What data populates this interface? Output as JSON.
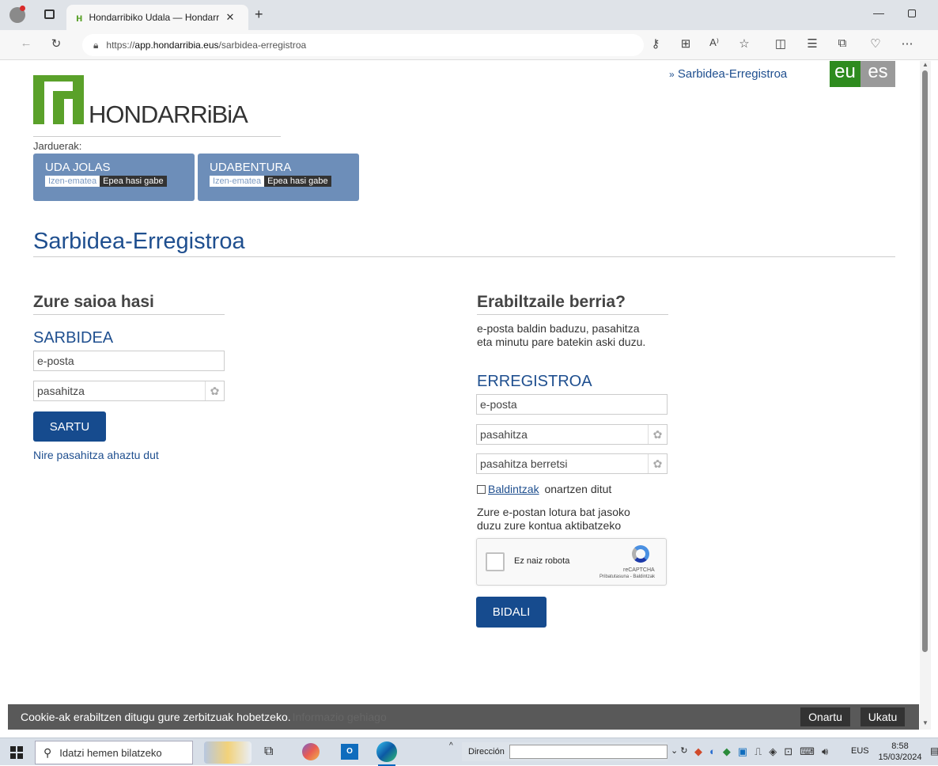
{
  "browser": {
    "tab_title": "Hondarribiko Udala — Hondarrib",
    "url_prefix": "https://",
    "url_domain": "app.hondarribia.eus",
    "url_path": "/sarbidea-erregistroa"
  },
  "header": {
    "logo_text": "HONDARRiBiA",
    "breadcrumb": "Sarbidea-Erregistroa",
    "lang_eu": "eu",
    "lang_es": "es",
    "activities_label": "Jarduerak:",
    "activities": [
      {
        "title": "UDA JOLAS",
        "tag1": "Izen-ematea",
        "tag2": "Epea hasi gabe"
      },
      {
        "title": "UDABENTURA",
        "tag1": "Izen-ematea",
        "tag2": "Epea hasi gabe"
      }
    ]
  },
  "page_title": "Sarbidea-Erregistroa",
  "login": {
    "heading": "Zure saioa hasi",
    "subheading": "SARBIDEA",
    "email_placeholder": "e-posta",
    "password_placeholder": "pasahitza",
    "submit": "SARTU",
    "forgot": "Nire pasahitza ahaztu dut"
  },
  "register": {
    "heading": "Erabiltzaile berria?",
    "intro_line1": "e-posta baldin baduzu, pasahitza",
    "intro_line2": "eta minutu pare batekin aski duzu.",
    "subheading": "ERREGISTROA",
    "email_placeholder": "e-posta",
    "password_placeholder": "pasahitza",
    "password_confirm_placeholder": "pasahitza berretsi",
    "terms_link": "Baldintzak",
    "terms_suffix": " onartzen ditut",
    "note_line1": "Zure e-postan lotura bat jasoko",
    "note_line2": "duzu zure kontua aktibatzeko",
    "captcha_label": "Ez naiz robota",
    "captcha_brand": "reCAPTCHA",
    "captcha_links": "Pribatutasuna - Baldintzak",
    "submit": "BIDALI"
  },
  "cookie": {
    "text": "Cookie-ak erabiltzen ditugu gure zerbitzuak hobetzeko.",
    "more": "Informazio gehiago",
    "accept": "Onartu",
    "reject": "Ukatu"
  },
  "taskbar": {
    "search_placeholder": "Idatzi hemen bilatzeko",
    "address_label": "Dirección",
    "lang": "EUS",
    "time": "8:58",
    "date": "15/03/2024"
  },
  "colors": {
    "brand_green": "#5aa12a",
    "brand_blue": "#1f4f8f",
    "button_blue": "#164b8e",
    "activity_blue": "#6d8eb9",
    "lang_active": "#2e8b1e",
    "lang_inactive": "#9a9a9a"
  }
}
